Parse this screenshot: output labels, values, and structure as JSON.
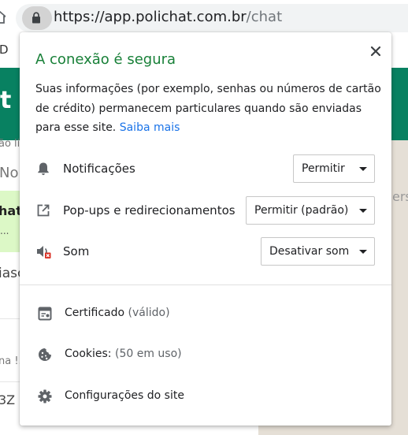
{
  "browser": {
    "url_host": "https://app.polichat.com.br",
    "url_path": "/chat"
  },
  "background_page": {
    "top_letter": "D",
    "header_letter": "t",
    "status_fragment": "ão li",
    "search_fragment": "No",
    "chat_name_fragment": "hat",
    "chat_preview_fragment": "...",
    "row_fragment": "iasc",
    "row2_fragment": "na !...",
    "row3_fragment": "3Z I",
    "right_fragment": "ers"
  },
  "popup": {
    "title": "A conexão é segura",
    "description": "Suas informações (por exemplo, senhas ou números de cartão de crédito) permanecem particulares quando são enviadas para esse site.",
    "learn_more": "Saiba mais",
    "permissions": [
      {
        "icon": "bell-icon",
        "label": "Notificações",
        "value": "Permitir"
      },
      {
        "icon": "open-in-new-icon",
        "label": "Pop-ups e redirecionamentos",
        "value": "Permitir (padrão)"
      },
      {
        "icon": "sound-muted-icon",
        "label": "Som",
        "value": "Desativar som"
      }
    ],
    "links": [
      {
        "icon": "certificate-icon",
        "label": "Certificado",
        "sublabel": "(válido)"
      },
      {
        "icon": "cookie-icon",
        "label": "Cookies:",
        "sublabel": "(50 em uso)"
      },
      {
        "icon": "gear-icon",
        "label": "Configurações do site",
        "sublabel": ""
      }
    ]
  },
  "colors": {
    "secure_title": "#188038",
    "link": "#1a73e8",
    "page_header_green": "#088161",
    "mute_badge_red": "#d93025"
  }
}
